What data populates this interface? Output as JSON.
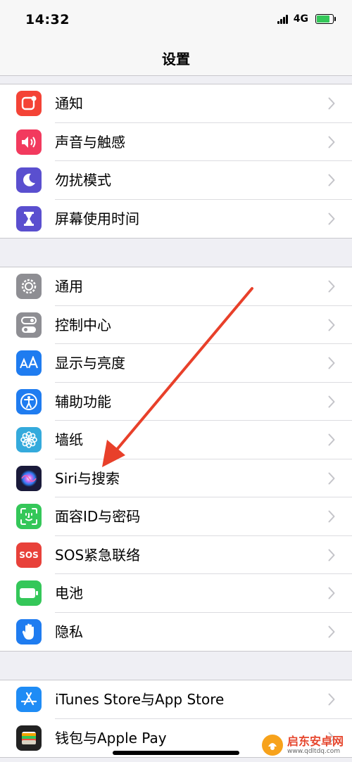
{
  "status": {
    "time": "14:32",
    "network": "4G"
  },
  "navbar": {
    "title": "设置"
  },
  "groups": [
    {
      "items": [
        {
          "label": "通知",
          "icon": "notifications-icon",
          "color": "#f44336"
        },
        {
          "label": "声音与触感",
          "icon": "sound-icon",
          "color": "#f23a5e"
        },
        {
          "label": "勿扰模式",
          "icon": "moon-icon",
          "color": "#5a4fcf"
        },
        {
          "label": "屏幕使用时间",
          "icon": "hourglass-icon",
          "color": "#5a4fcf"
        }
      ]
    },
    {
      "items": [
        {
          "label": "通用",
          "icon": "gear-icon",
          "color": "#8e8e93"
        },
        {
          "label": "控制中心",
          "icon": "toggles-icon",
          "color": "#8e8e93"
        },
        {
          "label": "显示与亮度",
          "icon": "text-size-icon",
          "color": "#1f7cf0"
        },
        {
          "label": "辅助功能",
          "icon": "accessibility-icon",
          "color": "#1f7cf0"
        },
        {
          "label": "墙纸",
          "icon": "flower-icon",
          "color": "#34aadc"
        },
        {
          "label": "Siri与搜索",
          "icon": "siri-icon",
          "color": "#1a1a3a"
        },
        {
          "label": "面容ID与密码",
          "icon": "face-id-icon",
          "color": "#34c759"
        },
        {
          "label": "SOS紧急联络",
          "icon": "sos-icon",
          "color": "#e8413a",
          "icon_text": "SOS"
        },
        {
          "label": "电池",
          "icon": "battery-icon",
          "color": "#34c759"
        },
        {
          "label": "隐私",
          "icon": "hand-icon",
          "color": "#1f7cf0"
        }
      ]
    },
    {
      "items": [
        {
          "label": "iTunes Store与App Store",
          "icon": "app-store-icon",
          "color": "#1f8cf5"
        },
        {
          "label": "钱包与Apple Pay",
          "icon": "wallet-icon",
          "color": "#222222"
        }
      ]
    }
  ],
  "annotation": {
    "arrow_color": "#e8402a"
  },
  "watermark": {
    "title": "启东安卓网",
    "url": "www.qdltdq.com"
  }
}
